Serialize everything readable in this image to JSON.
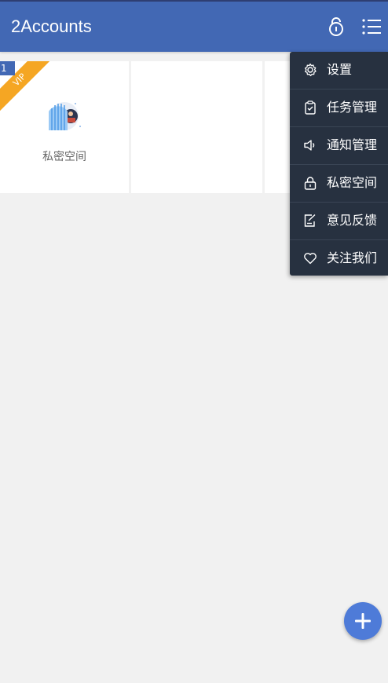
{
  "app": {
    "title": "2Accounts",
    "colors": {
      "appbar": "#4268b4",
      "menu_bg": "#273140",
      "vip_ribbon": "#f5a623",
      "fab": "#4e7bd8"
    }
  },
  "appbar_icons": [
    "lock-icon",
    "list-menu-icon"
  ],
  "grid": {
    "slots": [
      {
        "badge_number": "1",
        "ribbon": "VIP",
        "label": "私密空间",
        "icon": "private-space-icon"
      },
      {
        "label": ""
      },
      {
        "label": ""
      }
    ]
  },
  "menu": {
    "items": [
      {
        "label": "设置",
        "icon": "gear-icon"
      },
      {
        "label": "任务管理",
        "icon": "clipboard-icon"
      },
      {
        "label": "通知管理",
        "icon": "speaker-icon"
      },
      {
        "label": "私密空间",
        "icon": "lock-icon"
      },
      {
        "label": "意见反馈",
        "icon": "edit-note-icon"
      },
      {
        "label": "关注我们",
        "icon": "heart-icon"
      }
    ]
  },
  "fab": {
    "icon": "plus-icon"
  }
}
